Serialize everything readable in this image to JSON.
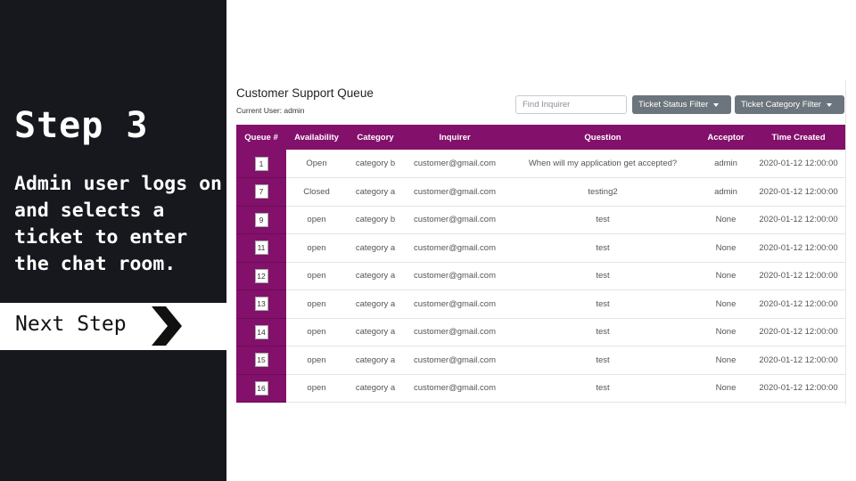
{
  "tutorial": {
    "step_title": "Step 3",
    "step_description": "Admin user logs on and selects a ticket to enter the chat room.",
    "next_label": "Next Step"
  },
  "app": {
    "title": "Customer Support Queue",
    "current_user": "Current User: admin",
    "search_placeholder": "Find Inquirer",
    "status_filter_label": "Ticket Status Filter",
    "category_filter_label": "Ticket Category Filter",
    "accent_color": "#83106b"
  },
  "table": {
    "headers": [
      "Queue #",
      "Availability",
      "Category",
      "Inquirer",
      "Question",
      "Acceptor",
      "Time Created"
    ],
    "rows": [
      [
        "1",
        "Open",
        "category b",
        "customer@gmail.com",
        "When will my application get accepted?",
        "admin",
        "2020-01-12 12:00:00"
      ],
      [
        "7",
        "Closed",
        "category a",
        "customer@gmail.com",
        "testing2",
        "admin",
        "2020-01-12 12:00:00"
      ],
      [
        "9",
        "open",
        "category b",
        "customer@gmail.com",
        "test",
        "None",
        "2020-01-12 12:00:00"
      ],
      [
        "11",
        "open",
        "category a",
        "customer@gmail.com",
        "test",
        "None",
        "2020-01-12 12:00:00"
      ],
      [
        "12",
        "open",
        "category a",
        "customer@gmail.com",
        "test",
        "None",
        "2020-01-12 12:00:00"
      ],
      [
        "13",
        "open",
        "category a",
        "customer@gmail.com",
        "test",
        "None",
        "2020-01-12 12:00:00"
      ],
      [
        "14",
        "open",
        "category a",
        "customer@gmail.com",
        "test",
        "None",
        "2020-01-12 12:00:00"
      ],
      [
        "15",
        "open",
        "category a",
        "customer@gmail.com",
        "test",
        "None",
        "2020-01-12 12:00:00"
      ],
      [
        "16",
        "open",
        "category a",
        "customer@gmail.com",
        "test",
        "None",
        "2020-01-12 12:00:00"
      ]
    ]
  }
}
